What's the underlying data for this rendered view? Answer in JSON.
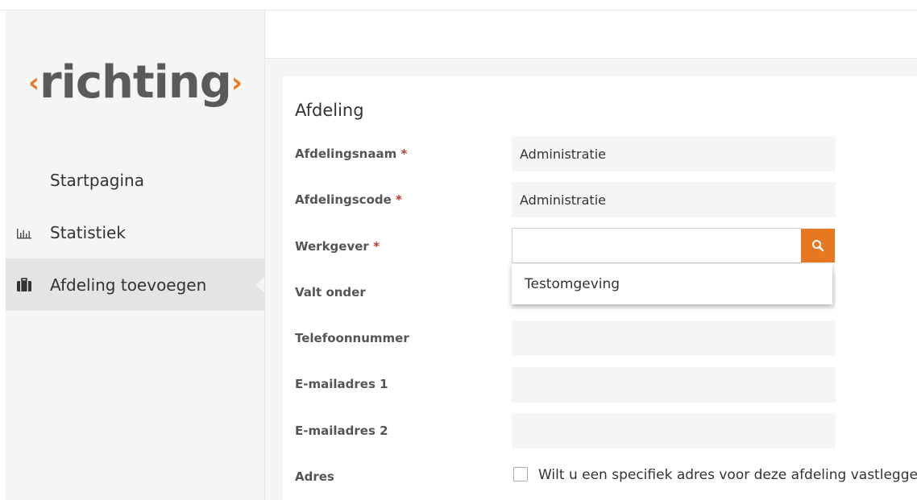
{
  "logo": {
    "left_chevron": "‹",
    "word": "richting",
    "right_chevron": "›",
    "accent": "#e87722",
    "text_color": "#5a5a5a"
  },
  "sidebar": {
    "items": [
      {
        "label": "Startpagina",
        "icon": "none"
      },
      {
        "label": "Statistiek",
        "icon": "bar-chart-icon"
      },
      {
        "label": "Afdeling toevoegen",
        "icon": "briefcase-icon",
        "active": true
      }
    ]
  },
  "form": {
    "title": "Afdeling",
    "fields": {
      "afdelingsnaam": {
        "label": "Afdelingsnaam",
        "required": "*",
        "value": "Administratie"
      },
      "afdelingscode": {
        "label": "Afdelingscode",
        "required": "*",
        "value": "Administratie"
      },
      "werkgever": {
        "label": "Werkgever",
        "required": "*",
        "value": ""
      },
      "valt_onder": {
        "label": "Valt onder",
        "value": ""
      },
      "telefoonnummer": {
        "label": "Telefoonnummer",
        "value": ""
      },
      "email1": {
        "label": "E-mailadres 1",
        "value": ""
      },
      "email2": {
        "label": "E-mailadres 2",
        "value": ""
      },
      "adres": {
        "label": "Adres",
        "checkbox_label": "Wilt u een specifiek adres voor deze afdeling vastleggen?",
        "checked": false
      }
    },
    "dropdown_option": "Testomgeving"
  }
}
